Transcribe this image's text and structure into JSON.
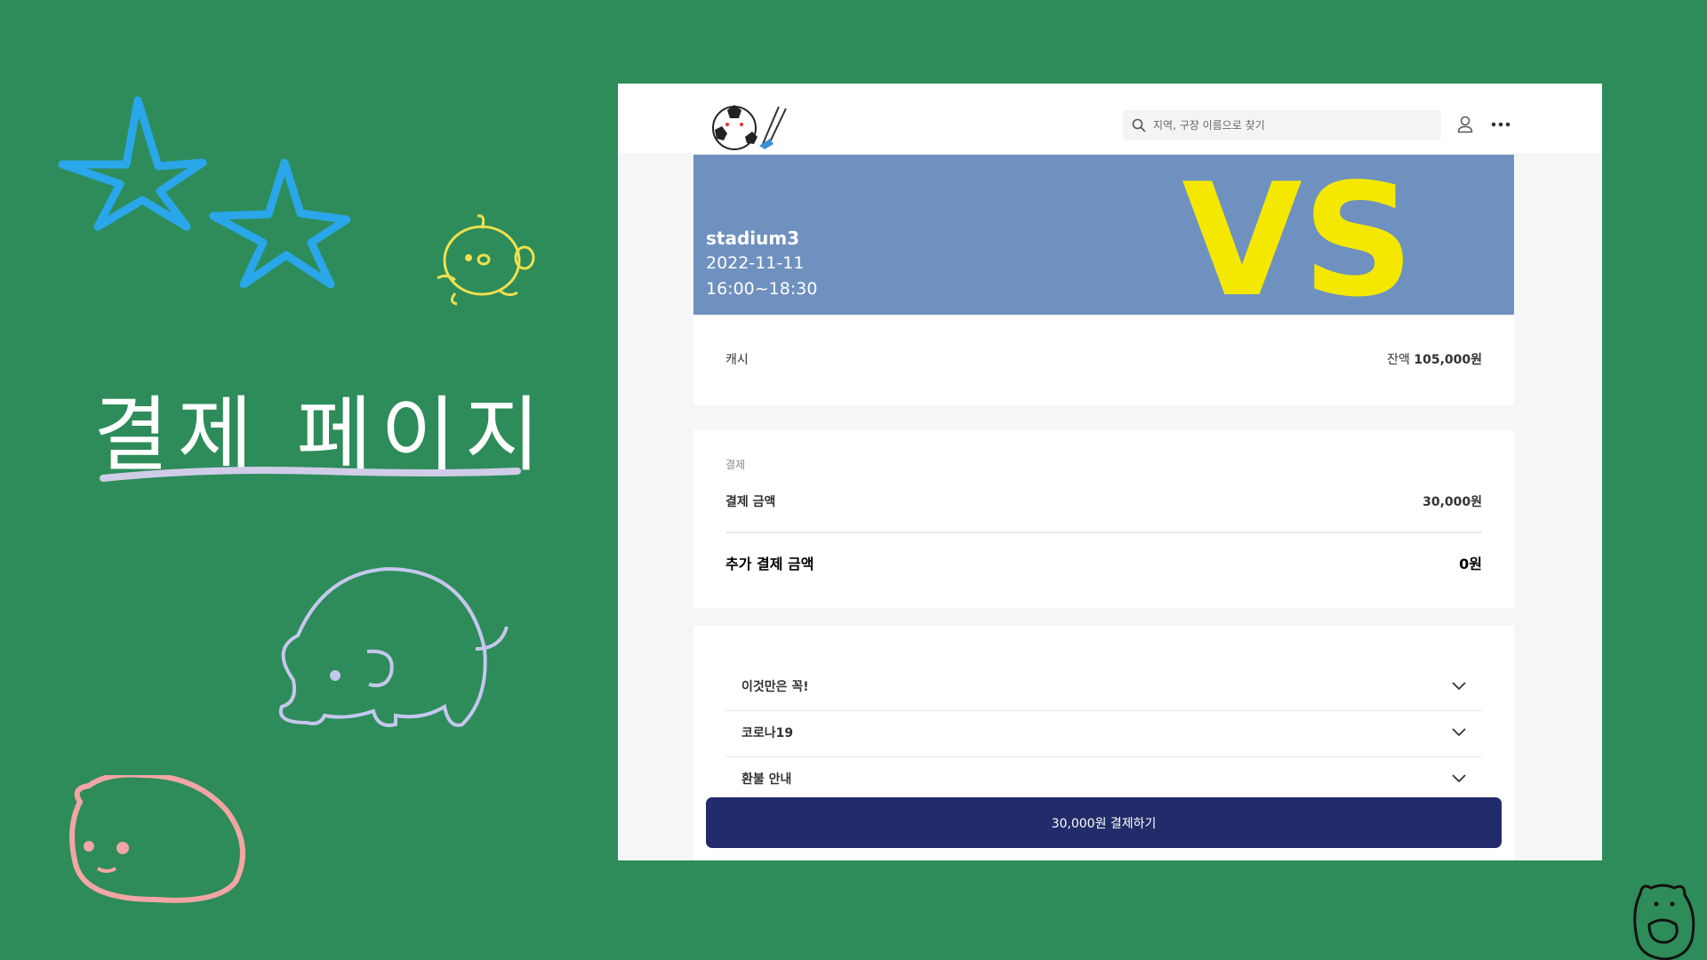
{
  "slide": {
    "title": "결제 페이지"
  },
  "header": {
    "search_placeholder": "지역, 구장 이름으로 찾기"
  },
  "match": {
    "stadium": "stadium3",
    "date": "2022-11-11",
    "time": "16:00~18:30",
    "vs_text": "VS"
  },
  "cash": {
    "label": "캐시",
    "balance_label": "잔액",
    "balance_value": "105,000원"
  },
  "payment": {
    "section_label": "결제",
    "amount_label": "결제 금액",
    "amount_value": "30,000원",
    "extra_label": "추가 결제 금액",
    "extra_value": "0원"
  },
  "info_sections": [
    {
      "label": "이것만은 꼭!"
    },
    {
      "label": "코로나19"
    },
    {
      "label": "환불 안내"
    }
  ],
  "pay_button": {
    "label": "30,000원 결제하기"
  },
  "colors": {
    "background": "#2d8c59",
    "hero": "#6f91bf",
    "vs": "#f5e800",
    "button": "#232c6a"
  }
}
